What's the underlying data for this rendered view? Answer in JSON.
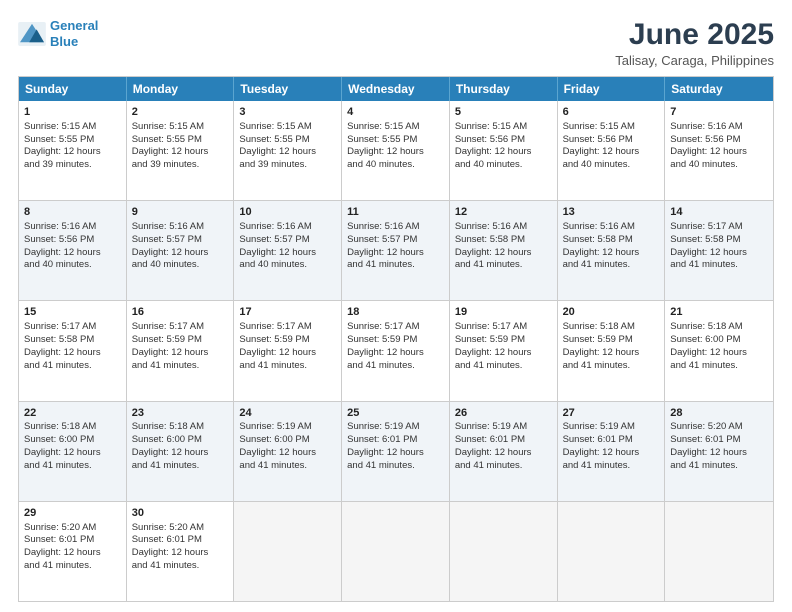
{
  "logo": {
    "line1": "General",
    "line2": "Blue"
  },
  "title": "June 2025",
  "subtitle": "Talisay, Caraga, Philippines",
  "weekdays": [
    "Sunday",
    "Monday",
    "Tuesday",
    "Wednesday",
    "Thursday",
    "Friday",
    "Saturday"
  ],
  "rows": [
    [
      {
        "day": "1",
        "lines": [
          "Sunrise: 5:15 AM",
          "Sunset: 5:55 PM",
          "Daylight: 12 hours",
          "and 39 minutes."
        ]
      },
      {
        "day": "2",
        "lines": [
          "Sunrise: 5:15 AM",
          "Sunset: 5:55 PM",
          "Daylight: 12 hours",
          "and 39 minutes."
        ]
      },
      {
        "day": "3",
        "lines": [
          "Sunrise: 5:15 AM",
          "Sunset: 5:55 PM",
          "Daylight: 12 hours",
          "and 39 minutes."
        ]
      },
      {
        "day": "4",
        "lines": [
          "Sunrise: 5:15 AM",
          "Sunset: 5:55 PM",
          "Daylight: 12 hours",
          "and 40 minutes."
        ]
      },
      {
        "day": "5",
        "lines": [
          "Sunrise: 5:15 AM",
          "Sunset: 5:56 PM",
          "Daylight: 12 hours",
          "and 40 minutes."
        ]
      },
      {
        "day": "6",
        "lines": [
          "Sunrise: 5:15 AM",
          "Sunset: 5:56 PM",
          "Daylight: 12 hours",
          "and 40 minutes."
        ]
      },
      {
        "day": "7",
        "lines": [
          "Sunrise: 5:16 AM",
          "Sunset: 5:56 PM",
          "Daylight: 12 hours",
          "and 40 minutes."
        ]
      }
    ],
    [
      {
        "day": "8",
        "lines": [
          "Sunrise: 5:16 AM",
          "Sunset: 5:56 PM",
          "Daylight: 12 hours",
          "and 40 minutes."
        ]
      },
      {
        "day": "9",
        "lines": [
          "Sunrise: 5:16 AM",
          "Sunset: 5:57 PM",
          "Daylight: 12 hours",
          "and 40 minutes."
        ]
      },
      {
        "day": "10",
        "lines": [
          "Sunrise: 5:16 AM",
          "Sunset: 5:57 PM",
          "Daylight: 12 hours",
          "and 40 minutes."
        ]
      },
      {
        "day": "11",
        "lines": [
          "Sunrise: 5:16 AM",
          "Sunset: 5:57 PM",
          "Daylight: 12 hours",
          "and 41 minutes."
        ]
      },
      {
        "day": "12",
        "lines": [
          "Sunrise: 5:16 AM",
          "Sunset: 5:58 PM",
          "Daylight: 12 hours",
          "and 41 minutes."
        ]
      },
      {
        "day": "13",
        "lines": [
          "Sunrise: 5:16 AM",
          "Sunset: 5:58 PM",
          "Daylight: 12 hours",
          "and 41 minutes."
        ]
      },
      {
        "day": "14",
        "lines": [
          "Sunrise: 5:17 AM",
          "Sunset: 5:58 PM",
          "Daylight: 12 hours",
          "and 41 minutes."
        ]
      }
    ],
    [
      {
        "day": "15",
        "lines": [
          "Sunrise: 5:17 AM",
          "Sunset: 5:58 PM",
          "Daylight: 12 hours",
          "and 41 minutes."
        ]
      },
      {
        "day": "16",
        "lines": [
          "Sunrise: 5:17 AM",
          "Sunset: 5:59 PM",
          "Daylight: 12 hours",
          "and 41 minutes."
        ]
      },
      {
        "day": "17",
        "lines": [
          "Sunrise: 5:17 AM",
          "Sunset: 5:59 PM",
          "Daylight: 12 hours",
          "and 41 minutes."
        ]
      },
      {
        "day": "18",
        "lines": [
          "Sunrise: 5:17 AM",
          "Sunset: 5:59 PM",
          "Daylight: 12 hours",
          "and 41 minutes."
        ]
      },
      {
        "day": "19",
        "lines": [
          "Sunrise: 5:17 AM",
          "Sunset: 5:59 PM",
          "Daylight: 12 hours",
          "and 41 minutes."
        ]
      },
      {
        "day": "20",
        "lines": [
          "Sunrise: 5:18 AM",
          "Sunset: 5:59 PM",
          "Daylight: 12 hours",
          "and 41 minutes."
        ]
      },
      {
        "day": "21",
        "lines": [
          "Sunrise: 5:18 AM",
          "Sunset: 6:00 PM",
          "Daylight: 12 hours",
          "and 41 minutes."
        ]
      }
    ],
    [
      {
        "day": "22",
        "lines": [
          "Sunrise: 5:18 AM",
          "Sunset: 6:00 PM",
          "Daylight: 12 hours",
          "and 41 minutes."
        ]
      },
      {
        "day": "23",
        "lines": [
          "Sunrise: 5:18 AM",
          "Sunset: 6:00 PM",
          "Daylight: 12 hours",
          "and 41 minutes."
        ]
      },
      {
        "day": "24",
        "lines": [
          "Sunrise: 5:19 AM",
          "Sunset: 6:00 PM",
          "Daylight: 12 hours",
          "and 41 minutes."
        ]
      },
      {
        "day": "25",
        "lines": [
          "Sunrise: 5:19 AM",
          "Sunset: 6:01 PM",
          "Daylight: 12 hours",
          "and 41 minutes."
        ]
      },
      {
        "day": "26",
        "lines": [
          "Sunrise: 5:19 AM",
          "Sunset: 6:01 PM",
          "Daylight: 12 hours",
          "and 41 minutes."
        ]
      },
      {
        "day": "27",
        "lines": [
          "Sunrise: 5:19 AM",
          "Sunset: 6:01 PM",
          "Daylight: 12 hours",
          "and 41 minutes."
        ]
      },
      {
        "day": "28",
        "lines": [
          "Sunrise: 5:20 AM",
          "Sunset: 6:01 PM",
          "Daylight: 12 hours",
          "and 41 minutes."
        ]
      }
    ],
    [
      {
        "day": "29",
        "lines": [
          "Sunrise: 5:20 AM",
          "Sunset: 6:01 PM",
          "Daylight: 12 hours",
          "and 41 minutes."
        ]
      },
      {
        "day": "30",
        "lines": [
          "Sunrise: 5:20 AM",
          "Sunset: 6:01 PM",
          "Daylight: 12 hours",
          "and 41 minutes."
        ]
      },
      {
        "day": "",
        "lines": []
      },
      {
        "day": "",
        "lines": []
      },
      {
        "day": "",
        "lines": []
      },
      {
        "day": "",
        "lines": []
      },
      {
        "day": "",
        "lines": []
      }
    ]
  ]
}
